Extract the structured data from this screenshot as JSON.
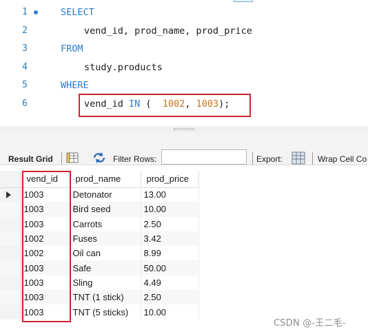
{
  "editor": {
    "lines": [
      {
        "num": "1",
        "tokens": [
          {
            "k": "SELECT",
            "t": "kw"
          }
        ]
      },
      {
        "num": "2",
        "tokens": [
          {
            "k": "vend_id, prod_name, prod_price",
            "t": "plain"
          }
        ]
      },
      {
        "num": "3",
        "tokens": [
          {
            "k": "FROM",
            "t": "kw"
          }
        ]
      },
      {
        "num": "4",
        "tokens": [
          {
            "k": "study.products",
            "t": "plain"
          }
        ]
      },
      {
        "num": "5",
        "tokens": [
          {
            "k": "WHERE",
            "t": "kw"
          }
        ]
      },
      {
        "num": "6",
        "tokens": [
          {
            "k": "vend_id ",
            "t": "plain"
          },
          {
            "k": "IN",
            "t": "kw"
          },
          {
            "k": " (  ",
            "t": "plain"
          },
          {
            "k": "1002",
            "t": "num"
          },
          {
            "k": ", ",
            "t": "plain"
          },
          {
            "k": "1003",
            "t": "num"
          },
          {
            "k": ");",
            "t": "plain"
          }
        ]
      }
    ]
  },
  "toolbar": {
    "result_grid": "Result Grid",
    "filter_rows": "Filter Rows:",
    "filter_value": "",
    "export": "Export:",
    "wrap_cell": "Wrap Cell Co"
  },
  "grid": {
    "columns": [
      "vend_id",
      "prod_name",
      "prod_price"
    ],
    "rows": [
      [
        "1003",
        "Detonator",
        "13.00"
      ],
      [
        "1003",
        "Bird seed",
        "10.00"
      ],
      [
        "1003",
        "Carrots",
        "2.50"
      ],
      [
        "1002",
        "Fuses",
        "3.42"
      ],
      [
        "1002",
        "Oil can",
        "8.99"
      ],
      [
        "1003",
        "Safe",
        "50.00"
      ],
      [
        "1003",
        "Sling",
        "4.49"
      ],
      [
        "1003",
        "TNT (1 stick)",
        "2.50"
      ],
      [
        "1003",
        "TNT (5 sticks)",
        "10.00"
      ]
    ]
  },
  "watermark": "CSDN @-王二毛-",
  "colors": {
    "keyword": "#2b7bd1",
    "number": "#c8741b",
    "highlight_box": "#d0222a"
  }
}
